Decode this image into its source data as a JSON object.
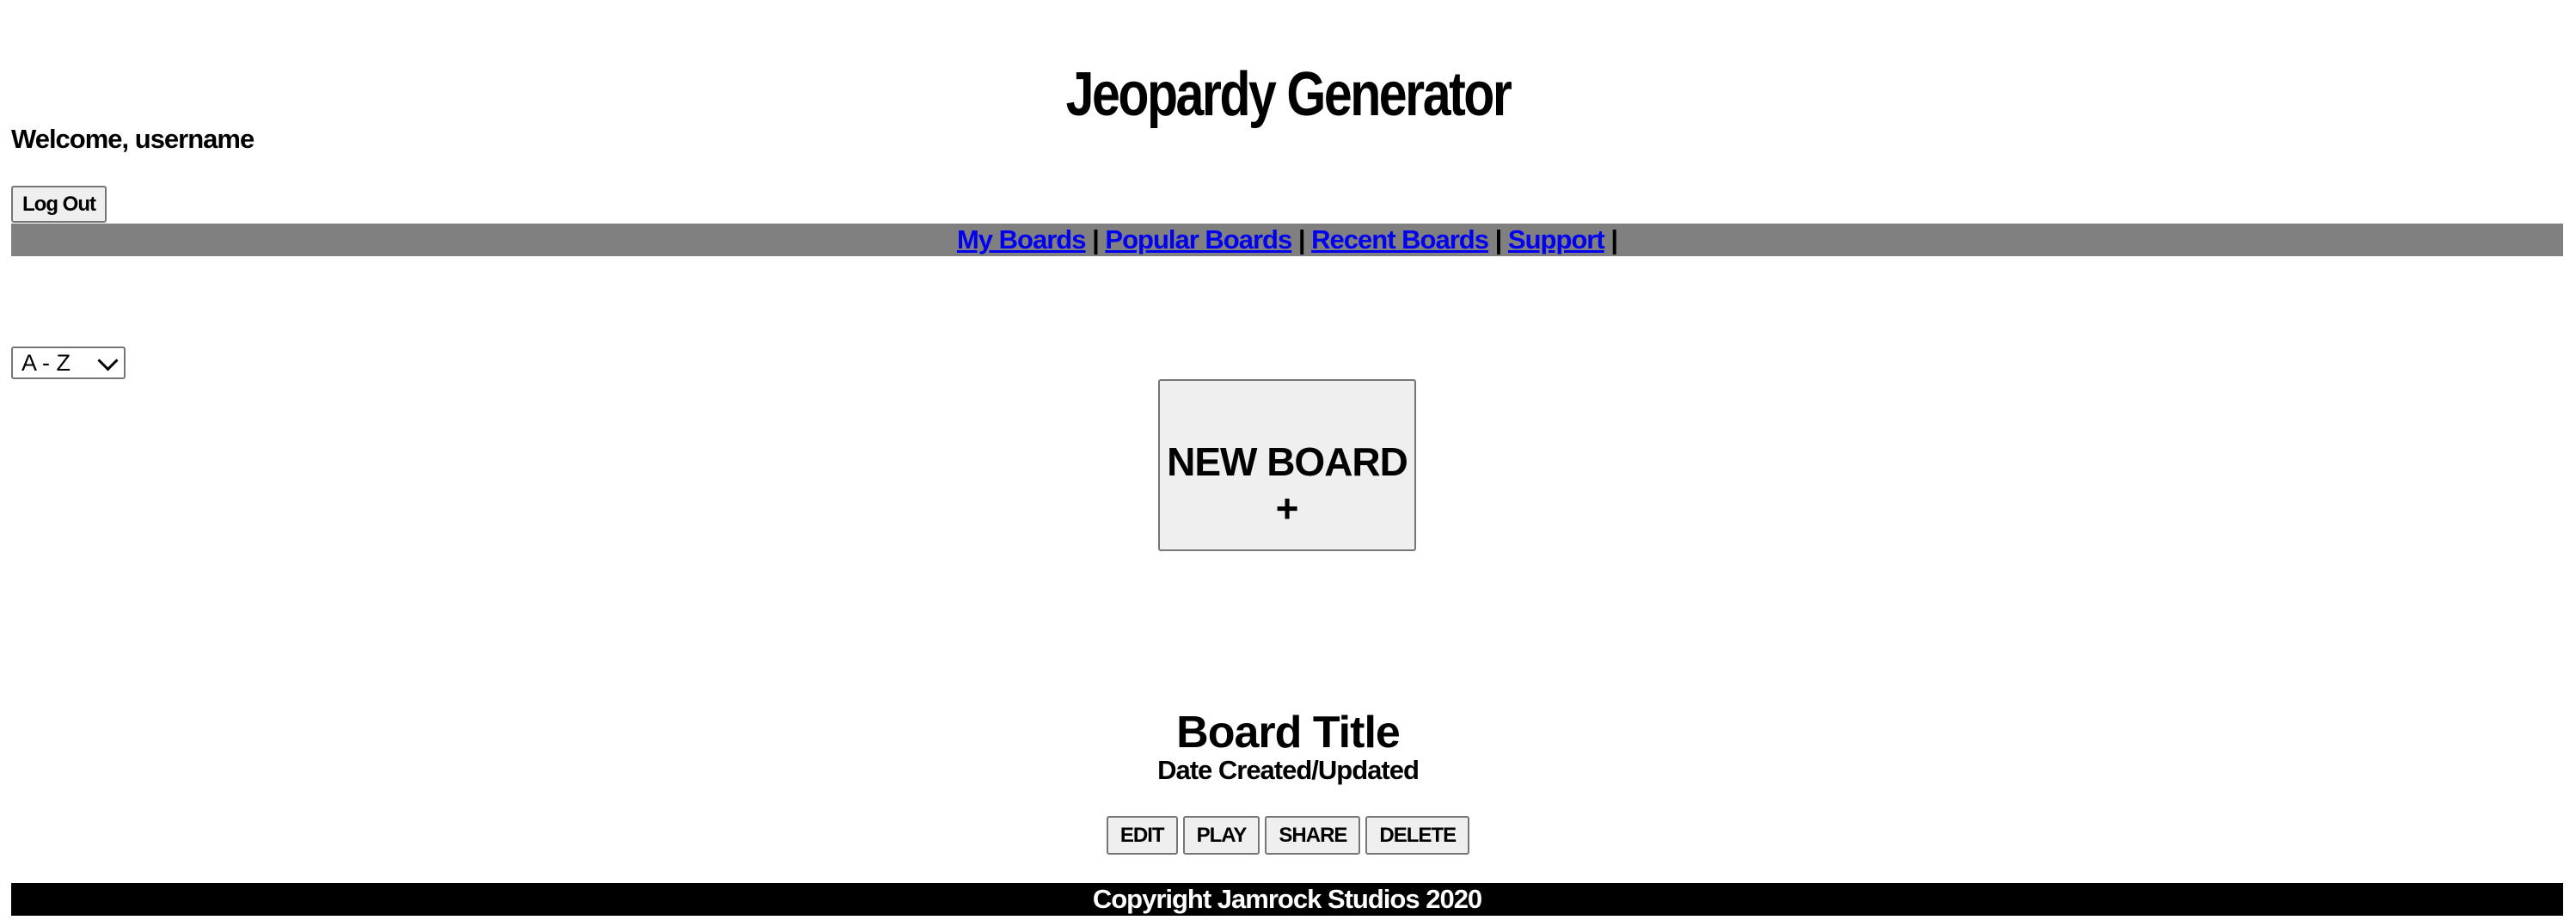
{
  "header": {
    "title": "Jeopardy Generator",
    "welcome": "Welcome, username",
    "logout_label": "Log Out"
  },
  "nav": {
    "items": [
      {
        "label": "My Boards"
      },
      {
        "label": "Popular Boards"
      },
      {
        "label": "Recent Boards"
      },
      {
        "label": "Support"
      }
    ],
    "separator": "|"
  },
  "sort": {
    "selected": "A - Z"
  },
  "new_board": {
    "label": "NEW BOARD",
    "plus": "+"
  },
  "board": {
    "title": "Board Title",
    "date": "Date Created/Updated",
    "actions": {
      "edit": "EDIT",
      "play": "PLAY",
      "share": "SHARE",
      "delete": "DELETE"
    }
  },
  "footer": {
    "text": "Copyright Jamrock Studios 2020"
  },
  "colors": {
    "nav_bg": "#808080",
    "link": "#0000ee",
    "footer_bg": "#000000",
    "footer_text": "#ffffff",
    "button_bg": "#efefef"
  }
}
